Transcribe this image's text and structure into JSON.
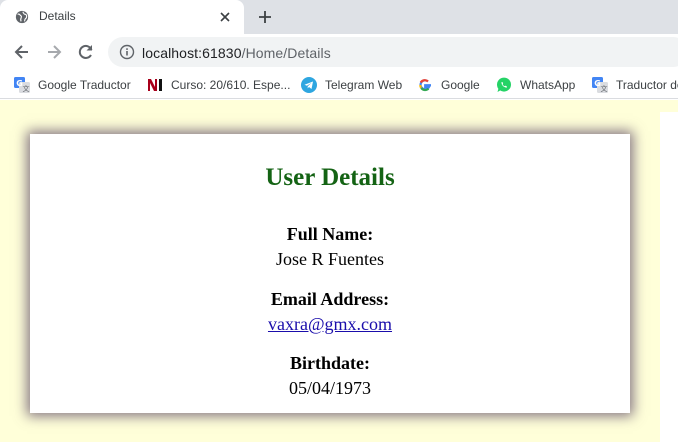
{
  "browser": {
    "tab": {
      "title": "Details",
      "favicon": "globe-icon",
      "close_icon": "close-icon"
    },
    "new_tab_icon": "plus-icon",
    "nav": {
      "back": "back-arrow-icon",
      "forward": "forward-arrow-icon",
      "reload": "reload-icon"
    },
    "omnibox": {
      "info_icon": "info-icon",
      "host": "localhost:61830",
      "path": "/Home/Details"
    },
    "bookmarks": [
      {
        "label": "Google Traductor",
        "icon": "google-translate-icon"
      },
      {
        "label": "Curso: 20/610. Espe...",
        "icon": "ni-logo-icon"
      },
      {
        "label": "Telegram Web",
        "icon": "telegram-icon"
      },
      {
        "label": "Google",
        "icon": "google-g-icon"
      },
      {
        "label": "WhatsApp",
        "icon": "whatsapp-icon"
      },
      {
        "label": "Traductor de",
        "icon": "google-translate-icon"
      }
    ]
  },
  "page": {
    "background_color": "#ffffd9",
    "title_color": "#146314",
    "title": "User Details",
    "fields": {
      "full_name": {
        "label": "Full Name:",
        "value": "Jose R Fuentes"
      },
      "email": {
        "label": "Email Address:",
        "value": "vaxra@gmx.com"
      },
      "birthdate": {
        "label": "Birthdate:",
        "value": "05/04/1973"
      }
    }
  }
}
